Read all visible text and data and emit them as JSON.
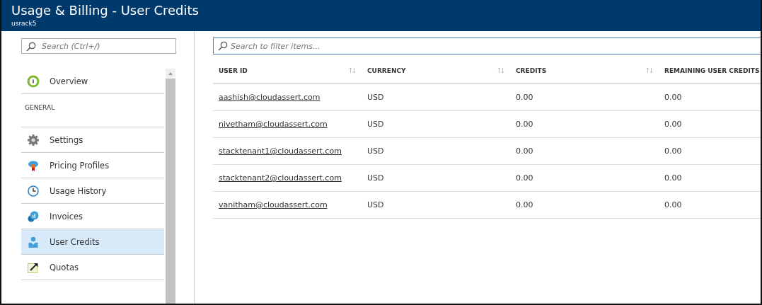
{
  "header": {
    "title": "Usage & Billing - User Credits",
    "subtitle": "usrack5"
  },
  "sidebar": {
    "search": {
      "placeholder": "Search (Ctrl+/)"
    },
    "top_items": [
      {
        "label": "Overview",
        "kind": "overview",
        "selected": false
      }
    ],
    "section": "GENERAL",
    "items": [
      {
        "label": "Settings",
        "kind": "settings",
        "selected": false
      },
      {
        "label": "Pricing Profiles",
        "kind": "pricing",
        "selected": false
      },
      {
        "label": "Usage History",
        "kind": "history",
        "selected": false
      },
      {
        "label": "Invoices",
        "kind": "invoices",
        "selected": false
      },
      {
        "label": "User Credits",
        "kind": "user",
        "selected": true
      },
      {
        "label": "Quotas",
        "kind": "quotas",
        "selected": false
      }
    ]
  },
  "filter": {
    "placeholder": "Search to filter items..."
  },
  "table": {
    "columns": [
      {
        "label": "USER ID",
        "sortable": true
      },
      {
        "label": "CURRENCY",
        "sortable": true
      },
      {
        "label": "CREDITS",
        "sortable": true
      },
      {
        "label": "REMAINING USER CREDITS"
      }
    ],
    "rows": [
      [
        "aashish@cloudassert.com",
        "USD",
        "0.00",
        "0.00"
      ],
      [
        "nivetham@cloudassert.com",
        "USD",
        "0.00",
        "0.00"
      ],
      [
        "stacktenant1@cloudassert.com",
        "USD",
        "0.00",
        "0.00"
      ],
      [
        "stacktenant2@cloudassert.com",
        "USD",
        "0.00",
        "0.00"
      ],
      [
        "vanitham@cloudassert.com",
        "USD",
        "0.00",
        "0.00"
      ]
    ]
  }
}
